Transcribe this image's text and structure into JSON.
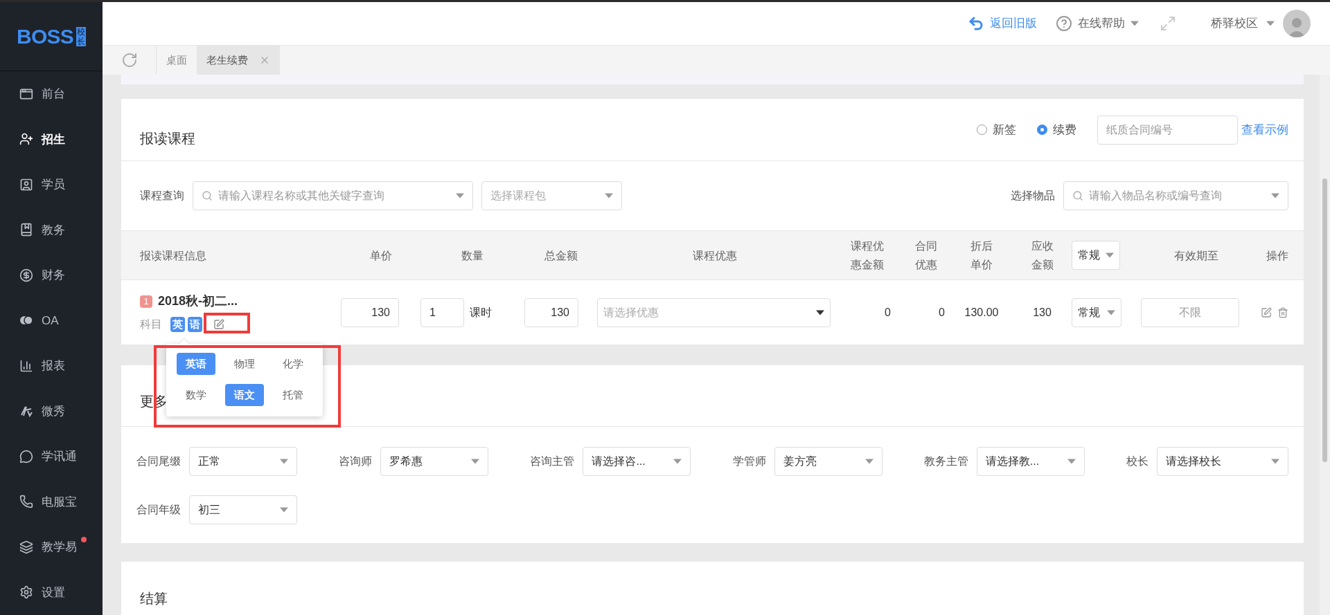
{
  "logo": {
    "text": "BOSS",
    "sub": "校长"
  },
  "sidebar": {
    "items": [
      {
        "label": "前台",
        "kind": "window",
        "selected": false,
        "dot": false
      },
      {
        "label": "招生",
        "kind": "user-plus",
        "selected": true,
        "dot": false
      },
      {
        "label": "学员",
        "kind": "id",
        "selected": false,
        "dot": false
      },
      {
        "label": "教务",
        "kind": "book",
        "selected": false,
        "dot": false
      },
      {
        "label": "财务",
        "kind": "yen",
        "selected": false,
        "dot": false
      },
      {
        "label": "OA",
        "kind": "oa",
        "selected": false,
        "dot": false
      },
      {
        "label": "报表",
        "kind": "bars",
        "selected": false,
        "dot": false
      },
      {
        "label": "微秀",
        "kind": "xiu",
        "selected": false,
        "dot": false
      },
      {
        "label": "学讯通",
        "kind": "pin",
        "selected": false,
        "dot": false
      },
      {
        "label": "电服宝",
        "kind": "phone",
        "selected": false,
        "dot": false
      },
      {
        "label": "教学易",
        "kind": "easy",
        "selected": false,
        "dot": true
      },
      {
        "label": "设置",
        "kind": "gear",
        "selected": false,
        "dot": false
      }
    ]
  },
  "header": {
    "back_link": "返回旧版",
    "help": "在线帮助",
    "campus": "桥驿校区"
  },
  "tabs": [
    {
      "label": "桌面",
      "selected": false,
      "closable": false
    },
    {
      "label": "老生续费",
      "selected": true,
      "closable": true
    }
  ],
  "course_card": {
    "title": "报读课程",
    "contract_types": [
      {
        "label": "新签",
        "selected": false
      },
      {
        "label": "续费",
        "selected": true
      }
    ],
    "paper_contract": {
      "placeholder": "纸质合同编号"
    },
    "example_link": "查看示例",
    "course_search": {
      "label": "课程查询",
      "placeholder": "请输入课程名称或其他关键字查询"
    },
    "package_select": {
      "placeholder": "选择课程包"
    },
    "item_search": {
      "label": "选择物品",
      "placeholder": "请输入物品名称或编号查询"
    },
    "table": {
      "columns": [
        "报读课程信息",
        "单价",
        "数量",
        "总金额",
        "课程优惠",
        "课程优惠金额",
        "合同优惠",
        "折后单价",
        "应收金额",
        "常规",
        "有效期至",
        "操作"
      ],
      "rows": [
        {
          "index": "1",
          "name": "2018秋-初二...",
          "subject_label": "科目",
          "subjects": [
            "英",
            "语"
          ],
          "unit_price": "130",
          "quantity": "1",
          "unit": "课时",
          "total": "130",
          "discount": {
            "placeholder": "请选择优惠"
          },
          "discount_amount": "0",
          "contract_discount": "0",
          "net_price": "130.00",
          "receivable": "130",
          "type": "常规",
          "valid_until": "不限"
        }
      ]
    }
  },
  "subject_popup": {
    "options": [
      {
        "label": "英语",
        "selected": true
      },
      {
        "label": "物理",
        "selected": false
      },
      {
        "label": "化学",
        "selected": false
      },
      {
        "label": "数学",
        "selected": false
      },
      {
        "label": "语文",
        "selected": true
      },
      {
        "label": "托管",
        "selected": false
      }
    ]
  },
  "more_card": {
    "title": "更多",
    "fields": [
      {
        "label": "合同尾缀",
        "value": "正常"
      },
      {
        "label": "咨询师",
        "value": "罗希惠"
      },
      {
        "label": "咨询主管",
        "value": "请选择咨..."
      },
      {
        "label": "学管师",
        "value": "姜方亮"
      },
      {
        "label": "教务主管",
        "value": "请选择教..."
      },
      {
        "label": "校长",
        "value": "请选择校长"
      },
      {
        "label": "合同年级",
        "value": "初三"
      }
    ]
  },
  "settle_card": {
    "title": "结算"
  }
}
